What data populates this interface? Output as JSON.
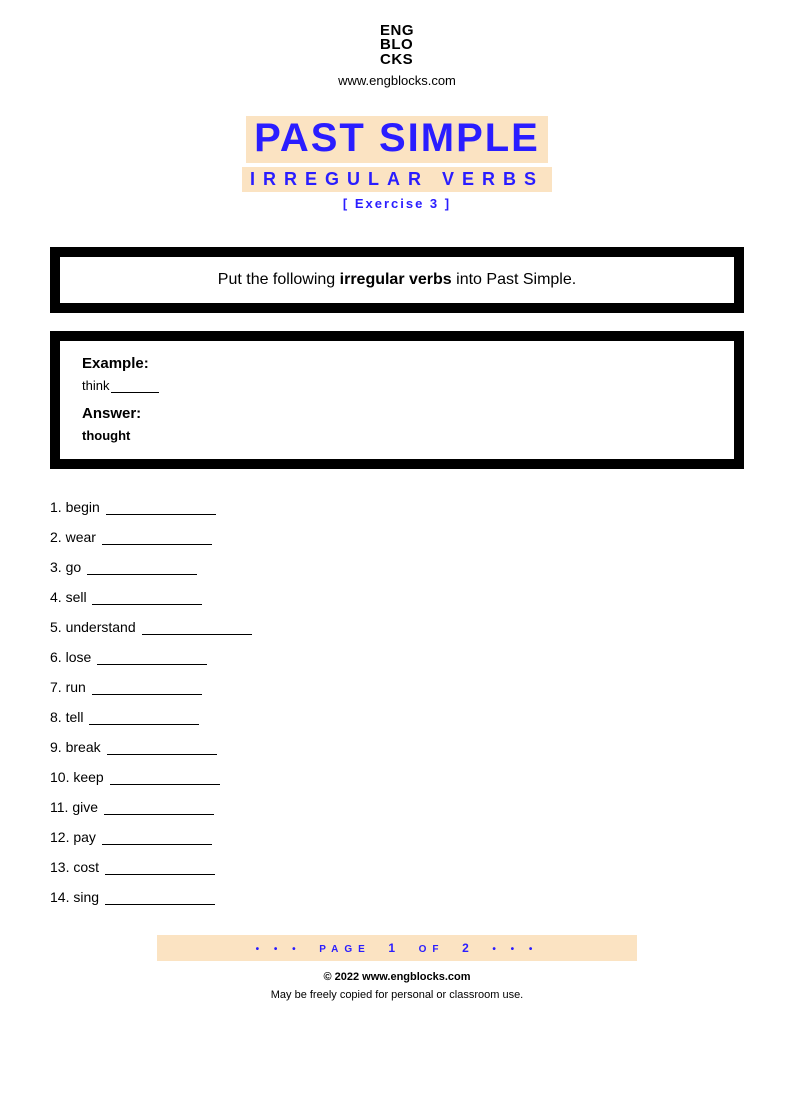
{
  "header": {
    "logo_lines": [
      "ENG",
      "BLO",
      "CKS"
    ],
    "site_url": "www.engblocks.com"
  },
  "title": {
    "line1": "PAST SIMPLE",
    "line2": "IRREGULAR VERBS",
    "line3": "[ Exercise 3 ]"
  },
  "instruction": {
    "pre": "Put the following ",
    "bold": "irregular verbs",
    "post": " into Past Simple."
  },
  "example": {
    "label": "Example:",
    "prompt_word": "think",
    "answer_label": "Answer:",
    "answer_value": "thought"
  },
  "items": [
    {
      "n": "1.",
      "word": "begin"
    },
    {
      "n": "2.",
      "word": "wear"
    },
    {
      "n": "3.",
      "word": "go"
    },
    {
      "n": "4.",
      "word": "sell"
    },
    {
      "n": "5.",
      "word": "understand"
    },
    {
      "n": "6.",
      "word": "lose"
    },
    {
      "n": "7.",
      "word": "run"
    },
    {
      "n": "8.",
      "word": "tell"
    },
    {
      "n": "9.",
      "word": "break"
    },
    {
      "n": "10.",
      "word": "keep"
    },
    {
      "n": "11.",
      "word": "give"
    },
    {
      "n": "12.",
      "word": "pay"
    },
    {
      "n": "13.",
      "word": "cost"
    },
    {
      "n": "14.",
      "word": "sing"
    }
  ],
  "footer": {
    "page_label_pre": "PAGE",
    "page_current": "1",
    "page_of": "OF",
    "page_total": "2",
    "copyright": "© 2022 www.engblocks.com",
    "license": "May be freely copied for personal or classroom use."
  }
}
